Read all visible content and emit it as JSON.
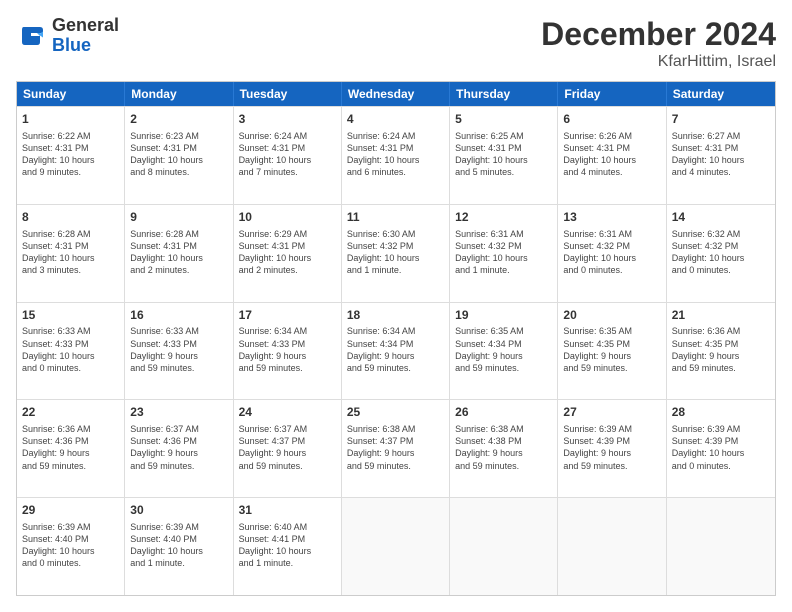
{
  "header": {
    "logo_general": "General",
    "logo_blue": "Blue",
    "month_title": "December 2024",
    "location": "KfarHittim, Israel"
  },
  "days_of_week": [
    "Sunday",
    "Monday",
    "Tuesday",
    "Wednesday",
    "Thursday",
    "Friday",
    "Saturday"
  ],
  "weeks": [
    [
      {
        "day": "1",
        "lines": [
          "Sunrise: 6:22 AM",
          "Sunset: 4:31 PM",
          "Daylight: 10 hours",
          "and 9 minutes."
        ]
      },
      {
        "day": "2",
        "lines": [
          "Sunrise: 6:23 AM",
          "Sunset: 4:31 PM",
          "Daylight: 10 hours",
          "and 8 minutes."
        ]
      },
      {
        "day": "3",
        "lines": [
          "Sunrise: 6:24 AM",
          "Sunset: 4:31 PM",
          "Daylight: 10 hours",
          "and 7 minutes."
        ]
      },
      {
        "day": "4",
        "lines": [
          "Sunrise: 6:24 AM",
          "Sunset: 4:31 PM",
          "Daylight: 10 hours",
          "and 6 minutes."
        ]
      },
      {
        "day": "5",
        "lines": [
          "Sunrise: 6:25 AM",
          "Sunset: 4:31 PM",
          "Daylight: 10 hours",
          "and 5 minutes."
        ]
      },
      {
        "day": "6",
        "lines": [
          "Sunrise: 6:26 AM",
          "Sunset: 4:31 PM",
          "Daylight: 10 hours",
          "and 4 minutes."
        ]
      },
      {
        "day": "7",
        "lines": [
          "Sunrise: 6:27 AM",
          "Sunset: 4:31 PM",
          "Daylight: 10 hours",
          "and 4 minutes."
        ]
      }
    ],
    [
      {
        "day": "8",
        "lines": [
          "Sunrise: 6:28 AM",
          "Sunset: 4:31 PM",
          "Daylight: 10 hours",
          "and 3 minutes."
        ]
      },
      {
        "day": "9",
        "lines": [
          "Sunrise: 6:28 AM",
          "Sunset: 4:31 PM",
          "Daylight: 10 hours",
          "and 2 minutes."
        ]
      },
      {
        "day": "10",
        "lines": [
          "Sunrise: 6:29 AM",
          "Sunset: 4:31 PM",
          "Daylight: 10 hours",
          "and 2 minutes."
        ]
      },
      {
        "day": "11",
        "lines": [
          "Sunrise: 6:30 AM",
          "Sunset: 4:32 PM",
          "Daylight: 10 hours",
          "and 1 minute."
        ]
      },
      {
        "day": "12",
        "lines": [
          "Sunrise: 6:31 AM",
          "Sunset: 4:32 PM",
          "Daylight: 10 hours",
          "and 1 minute."
        ]
      },
      {
        "day": "13",
        "lines": [
          "Sunrise: 6:31 AM",
          "Sunset: 4:32 PM",
          "Daylight: 10 hours",
          "and 0 minutes."
        ]
      },
      {
        "day": "14",
        "lines": [
          "Sunrise: 6:32 AM",
          "Sunset: 4:32 PM",
          "Daylight: 10 hours",
          "and 0 minutes."
        ]
      }
    ],
    [
      {
        "day": "15",
        "lines": [
          "Sunrise: 6:33 AM",
          "Sunset: 4:33 PM",
          "Daylight: 10 hours",
          "and 0 minutes."
        ]
      },
      {
        "day": "16",
        "lines": [
          "Sunrise: 6:33 AM",
          "Sunset: 4:33 PM",
          "Daylight: 9 hours",
          "and 59 minutes."
        ]
      },
      {
        "day": "17",
        "lines": [
          "Sunrise: 6:34 AM",
          "Sunset: 4:33 PM",
          "Daylight: 9 hours",
          "and 59 minutes."
        ]
      },
      {
        "day": "18",
        "lines": [
          "Sunrise: 6:34 AM",
          "Sunset: 4:34 PM",
          "Daylight: 9 hours",
          "and 59 minutes."
        ]
      },
      {
        "day": "19",
        "lines": [
          "Sunrise: 6:35 AM",
          "Sunset: 4:34 PM",
          "Daylight: 9 hours",
          "and 59 minutes."
        ]
      },
      {
        "day": "20",
        "lines": [
          "Sunrise: 6:35 AM",
          "Sunset: 4:35 PM",
          "Daylight: 9 hours",
          "and 59 minutes."
        ]
      },
      {
        "day": "21",
        "lines": [
          "Sunrise: 6:36 AM",
          "Sunset: 4:35 PM",
          "Daylight: 9 hours",
          "and 59 minutes."
        ]
      }
    ],
    [
      {
        "day": "22",
        "lines": [
          "Sunrise: 6:36 AM",
          "Sunset: 4:36 PM",
          "Daylight: 9 hours",
          "and 59 minutes."
        ]
      },
      {
        "day": "23",
        "lines": [
          "Sunrise: 6:37 AM",
          "Sunset: 4:36 PM",
          "Daylight: 9 hours",
          "and 59 minutes."
        ]
      },
      {
        "day": "24",
        "lines": [
          "Sunrise: 6:37 AM",
          "Sunset: 4:37 PM",
          "Daylight: 9 hours",
          "and 59 minutes."
        ]
      },
      {
        "day": "25",
        "lines": [
          "Sunrise: 6:38 AM",
          "Sunset: 4:37 PM",
          "Daylight: 9 hours",
          "and 59 minutes."
        ]
      },
      {
        "day": "26",
        "lines": [
          "Sunrise: 6:38 AM",
          "Sunset: 4:38 PM",
          "Daylight: 9 hours",
          "and 59 minutes."
        ]
      },
      {
        "day": "27",
        "lines": [
          "Sunrise: 6:39 AM",
          "Sunset: 4:39 PM",
          "Daylight: 9 hours",
          "and 59 minutes."
        ]
      },
      {
        "day": "28",
        "lines": [
          "Sunrise: 6:39 AM",
          "Sunset: 4:39 PM",
          "Daylight: 10 hours",
          "and 0 minutes."
        ]
      }
    ],
    [
      {
        "day": "29",
        "lines": [
          "Sunrise: 6:39 AM",
          "Sunset: 4:40 PM",
          "Daylight: 10 hours",
          "and 0 minutes."
        ]
      },
      {
        "day": "30",
        "lines": [
          "Sunrise: 6:39 AM",
          "Sunset: 4:40 PM",
          "Daylight: 10 hours",
          "and 1 minute."
        ]
      },
      {
        "day": "31",
        "lines": [
          "Sunrise: 6:40 AM",
          "Sunset: 4:41 PM",
          "Daylight: 10 hours",
          "and 1 minute."
        ]
      },
      null,
      null,
      null,
      null
    ]
  ]
}
